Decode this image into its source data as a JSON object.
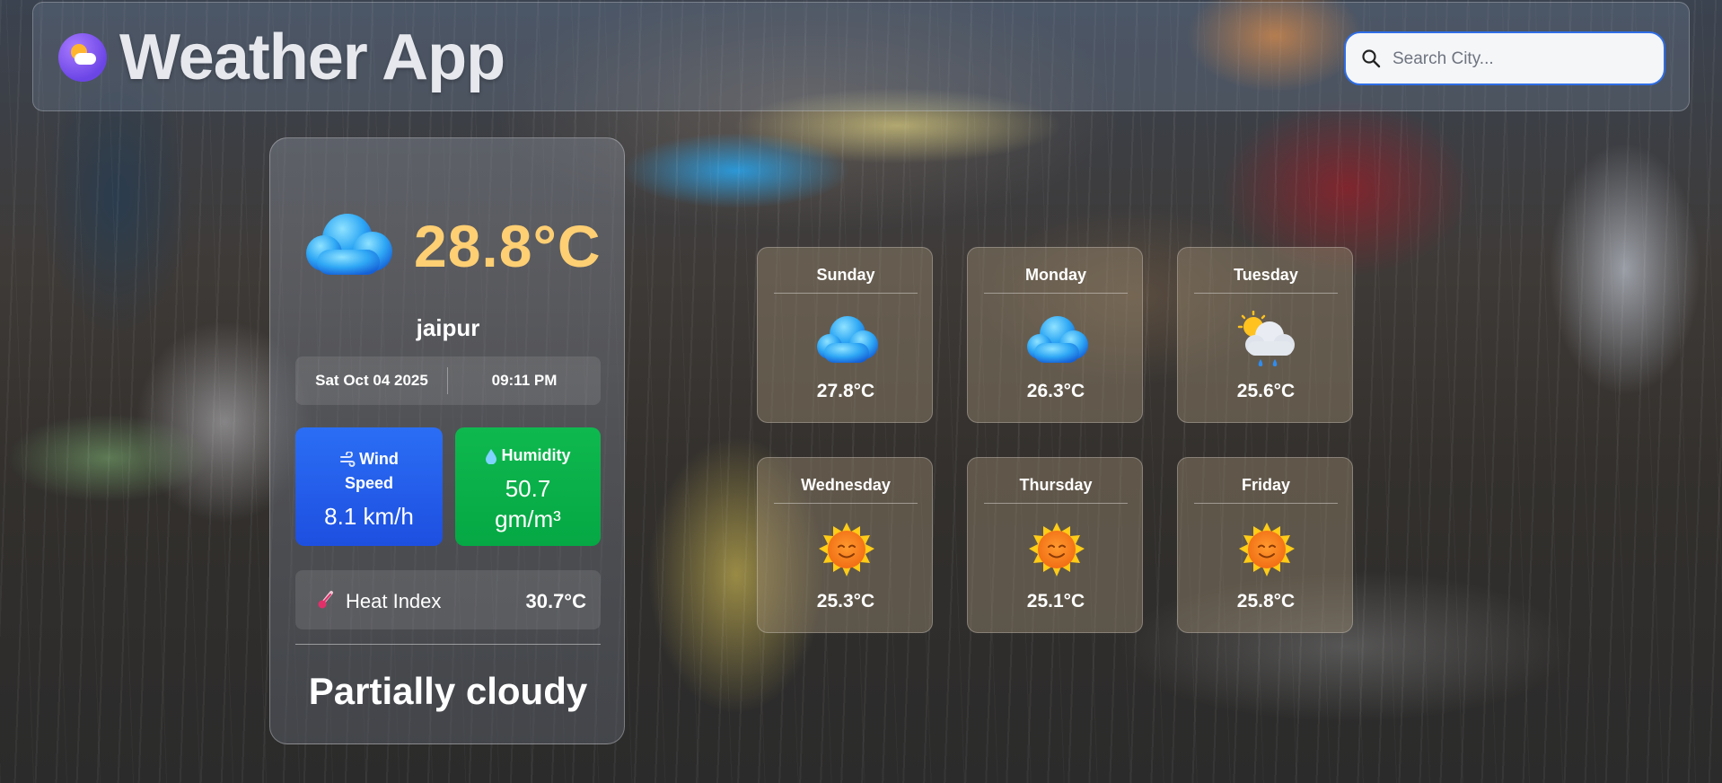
{
  "header": {
    "app_title": "Weather App",
    "search_placeholder": "Search City..."
  },
  "current": {
    "temperature": "28.8°C",
    "city": "jaipur",
    "date": "Sat Oct 04 2025",
    "time": "09:11 PM",
    "wind": {
      "label": "Wind Speed",
      "value": "8.1 km/h",
      "icon": "wind-icon"
    },
    "humidity": {
      "label": "Humidity",
      "value": "50.7 gm/m³",
      "icon": "droplet-icon"
    },
    "heat_index": {
      "label": "Heat Index",
      "value": "30.7°C",
      "icon": "thermometer-icon"
    },
    "condition": "Partially cloudy",
    "icon": "cloud-icon"
  },
  "forecast": [
    {
      "day": "Sunday",
      "temp": "27.8°C",
      "icon": "cloud-icon"
    },
    {
      "day": "Monday",
      "temp": "26.3°C",
      "icon": "cloud-icon"
    },
    {
      "day": "Tuesday",
      "temp": "25.6°C",
      "icon": "sun-rain-cloud-icon"
    },
    {
      "day": "Wednesday",
      "temp": "25.3°C",
      "icon": "sun-icon"
    },
    {
      "day": "Thursday",
      "temp": "25.1°C",
      "icon": "sun-icon"
    },
    {
      "day": "Friday",
      "temp": "25.8°C",
      "icon": "sun-icon"
    }
  ],
  "colors": {
    "temperature": "#ffcf73",
    "wind_card": "#2b6ef5",
    "humidity_card": "#0fb84f",
    "search_border": "#2e6de6"
  }
}
